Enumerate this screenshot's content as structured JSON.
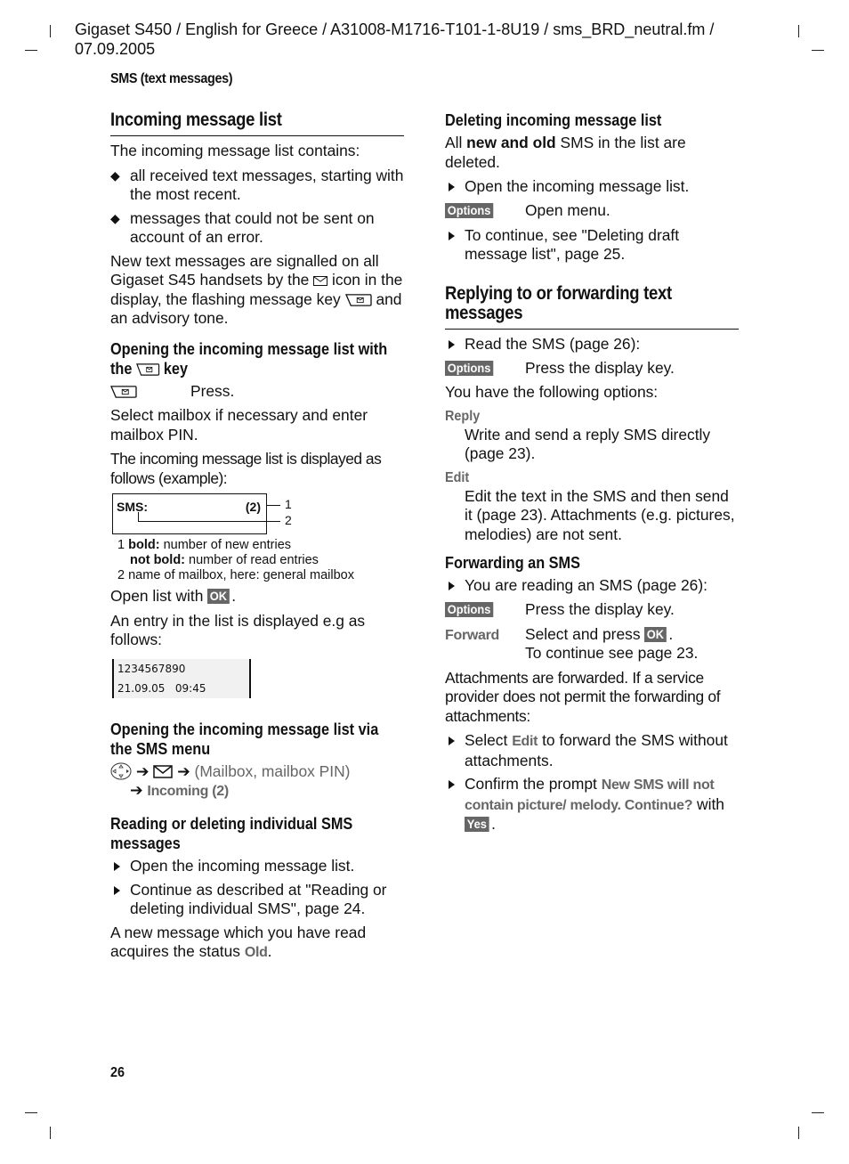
{
  "header": {
    "line1": "Gigaset S450 / English for Greece / A31008-M1716-T101-1-8U19 / sms_BRD_neutral.fm /",
    "line2": "07.09.2005"
  },
  "section_label": "SMS (text messages)",
  "page_number": "26",
  "left": {
    "title": "Incoming message list",
    "intro": "The incoming message list contains:",
    "bullets": [
      "all received text messages, starting with the most recent.",
      "messages that could not be sent on account of an error."
    ],
    "signal_p1": "New text messages are signalled on all Gigaset S45 handsets by the",
    "signal_p2": "icon in the display, the flashing message key",
    "signal_p3": "and an advisory tone.",
    "open_key": {
      "heading_a": "Opening the incoming message list with the",
      "heading_b": "key",
      "press": "Press.",
      "select_mailbox": "Select mailbox if necessary and enter mailbox PIN.",
      "display_intro": "The incoming message list is displayed as follows (example):",
      "display": {
        "label": "SMS:",
        "count": "(2)",
        "callout1": "1",
        "callout2": "2"
      },
      "legend": {
        "n1": "1",
        "bold_term": "bold:",
        "bold_desc": "number of new entries",
        "notbold_term": "not bold:",
        "notbold_desc": "number of read entries",
        "n2": "2",
        "n2_desc": "name of mailbox, here: general mailbox"
      },
      "open_with": "Open list with",
      "ok": "OK",
      "entry_intro": "An entry in the list is displayed e.g as follows:",
      "entry": {
        "number": "1234567890",
        "date": "21.09.05",
        "time": "09:45"
      }
    },
    "via_menu": {
      "heading": "Opening the incoming message list via the SMS menu",
      "path_text": "(Mailbox, mailbox PIN)",
      "incoming": "Incoming  (2)"
    },
    "reading": {
      "heading": "Reading or deleting individual SMS messages",
      "steps": [
        "Open the incoming message list.",
        "Continue as described at \"Reading or deleting individual SMS\", page 24."
      ],
      "status_text": "A new message which you have read acquires the status",
      "status_old": "Old"
    }
  },
  "right": {
    "deleting": {
      "heading": "Deleting incoming message list",
      "p_a": "All",
      "p_bold": "new and old",
      "p_b": "SMS in the list are deleted.",
      "step1": "Open the incoming message list.",
      "options": "Options",
      "open_menu": "Open menu.",
      "step2": "To continue, see \"Deleting draft message list\", page 25."
    },
    "reply": {
      "title": "Replying to or forwarding text messages",
      "step1": "Read the SMS (page 26):",
      "options": "Options",
      "press_display": "Press the display key.",
      "have_options": "You have the following options:",
      "opt_reply": "Reply",
      "opt_reply_desc": "Write and send a reply SMS directly (page 23).",
      "opt_edit": "Edit",
      "opt_edit_desc": "Edit the text in the SMS and then send it (page 23). Attachments (e.g. pictures, melodies) are not sent."
    },
    "forwarding": {
      "heading": "Forwarding an SMS",
      "step1": "You are reading an SMS (page 26):",
      "options": "Options",
      "press_display": "Press the display key.",
      "forward": "Forward",
      "select_press": "Select and press",
      "ok": "OK",
      "continue": "To continue see page 23.",
      "attachments": "Attachments are forwarded. If a service provider does not permit the forwarding of attachments:",
      "step_select_a": "Select",
      "step_select_edit": "Edit",
      "step_select_b": "to forward the SMS without attachments.",
      "step_confirm_a": "Confirm the prompt",
      "prompt": "New SMS will not contain picture/  melody. Continue?",
      "step_confirm_b": "with",
      "yes": "Yes"
    }
  }
}
